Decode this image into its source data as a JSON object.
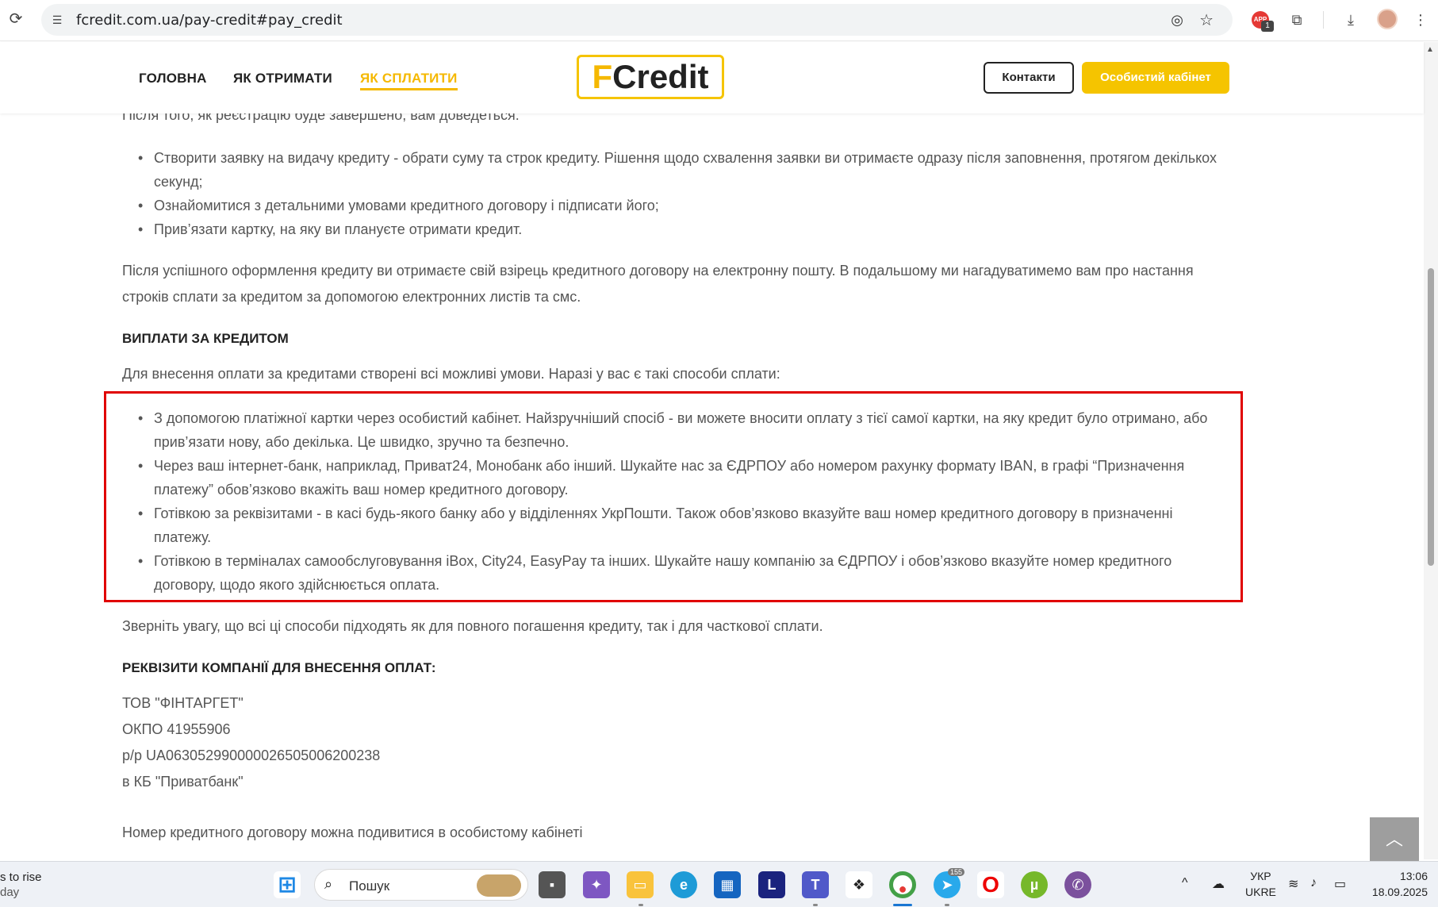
{
  "browser": {
    "url": "fcredit.com.ua/pay-credit#pay_credit",
    "ext_badge": "APP",
    "ext_badge_count": "1"
  },
  "header": {
    "nav": [
      "ГОЛОВНА",
      "ЯК ОТРИМАТИ",
      "ЯК СПЛАТИТИ"
    ],
    "logo_f": "F",
    "logo_rest": "Credit",
    "contacts_label": "Контакти",
    "cabinet_label": "Особистий кабінет",
    "accent_color": "#f5c400"
  },
  "content": {
    "intro_cut": "Після того, як реєстрацію буде завершено, вам доведеться:",
    "steps": [
      "Створити заявку на видачу кредиту - обрати суму та строк кредиту. Рішення щодо схвалення заявки ви отримаєте одразу після заповнення, протягом декількох секунд;",
      "Ознайомитися з детальними умовами кредитного договору і підписати його;",
      "Прив’язати картку, на яку ви плануєте отримати кредит."
    ],
    "after_para": "Після успішного оформлення кредиту ви отримаєте свій взірець кредитного договору на електронну пошту. В подальшому ми нагадуватимемо вам про настання строків сплати за кредитом за допомогою електронних листів та смс.",
    "payments_heading": "ВИПЛАТИ ЗА КРЕДИТОМ",
    "payments_intro": "Для внесення оплати за кредитами створені всі можливі умови. Наразі у вас є такі способи сплати:",
    "payment_methods": [
      "З допомогою платіжної картки через особистий кабінет. Найзручніший спосіб - ви можете вносити оплату з тієї самої картки, на яку кредит було отримано, або прив’язати нову, або декілька. Це швидко, зручно та безпечно.",
      "Через ваш інтернет-банк, наприклад, Приват24, Монобанк або інший. Шукайте нас за ЄДРПОУ або номером рахунку формату IBAN, в графі “Призначення платежу” обов’язково вкажіть ваш номер кредитного договору.",
      "Готівкою за реквізитами - в касі будь-якого банку або у відділеннях УкрПошти. Також обов’язково вказуйте ваш номер кредитного договору в призначенні платежу.",
      "Готівкою в терміналах самообслуговування iBox, City24, EasyPay та інших. Шукайте нашу компанію за ЄДРПОУ і обов’язково вказуйте номер кредитного договору, щодо якого здійснюється оплата."
    ],
    "note": "Зверніть увагу, що всі ці способи підходять як для повного погашення кредиту, так і для часткової сплати.",
    "requisites_heading": "РЕКВІЗИТИ КОМПАНІЇ ДЛЯ ВНЕСЕННЯ ОПЛАТ:",
    "requisites": [
      "ТОВ \"ФІНТАРГЕТ\"",
      "ОКПО 41955906",
      "р/р UA063052990000026505006200238",
      "в КБ \"Приватбанк\""
    ],
    "contract_note": "Номер кредитного договору можна подивитися в особистому кабінеті"
  },
  "taskbar": {
    "weather_line1": "s to rise",
    "weather_line2": "day",
    "search_label": "Пошук",
    "lang_line1": "УКР",
    "lang_line2": "UKRE",
    "time": "13:06",
    "date": "18.09.2025",
    "telegram_badge": "155"
  }
}
